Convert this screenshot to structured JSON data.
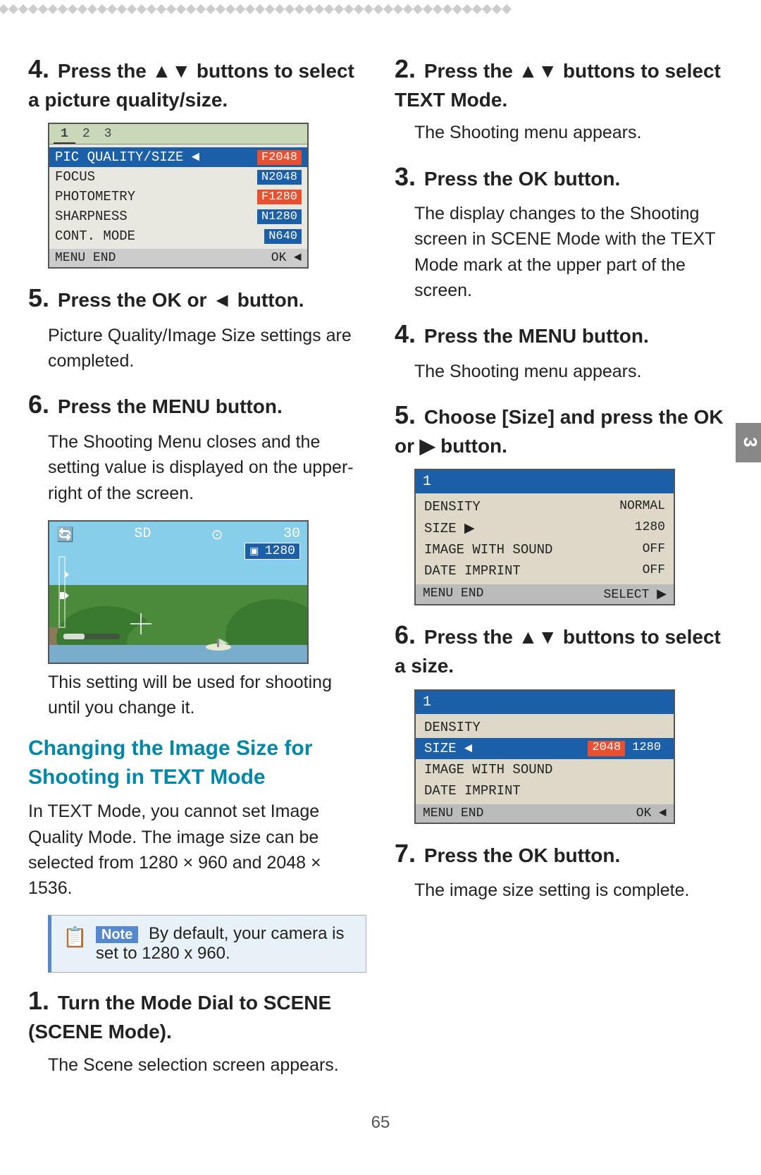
{
  "page": {
    "number": "65",
    "tab_number": "3"
  },
  "decorative_dots_count": 52,
  "left_column": {
    "step4": {
      "number": "4.",
      "heading": "Press the ▲▼ buttons to select a picture quality/size.",
      "camera_screen": {
        "tabs": [
          "1",
          "2",
          "3"
        ],
        "rows": [
          {
            "label": "PIC QUALITY/SIZE ◄",
            "value": "F2048",
            "selected": true
          },
          {
            "label": "FOCUS",
            "value": "N2048",
            "selected": false
          },
          {
            "label": "PHOTOMETRY",
            "value": "F1280",
            "selected": false
          },
          {
            "label": "SHARPNESS",
            "value": "N1280",
            "selected": false
          },
          {
            "label": "CONT. MODE",
            "value": "N640",
            "selected": false
          }
        ],
        "footer_left": "MENU END",
        "footer_right": "OK ◄"
      }
    },
    "step5": {
      "number": "5.",
      "heading": "Press the OK or ◄ button.",
      "body": "Picture Quality/Image Size settings are completed."
    },
    "step6": {
      "number": "6.",
      "heading": "Press the MENU button.",
      "body": "The Shooting Menu closes and the setting value is displayed on the upper-right of the screen.",
      "preview_badge": "1280",
      "preview_icons": [
        "🔄",
        "SD",
        "⊙",
        "30"
      ],
      "caption": "This setting will be used for shooting until you change it."
    },
    "section_heading": "Changing the Image Size for Shooting in TEXT Mode",
    "section_body": "In TEXT Mode, you cannot set Image Quality Mode. The image size can be selected from 1280 × 960 and 2048 × 1536.",
    "note": {
      "label": "Note",
      "text": "By default, your camera is set to 1280 x 960."
    },
    "step1": {
      "number": "1.",
      "heading": "Turn the Mode Dial to SCENE (SCENE Mode).",
      "body": "The Scene selection screen appears."
    }
  },
  "right_column": {
    "step2": {
      "number": "2.",
      "heading": "Press the ▲▼ buttons to select TEXT Mode.",
      "body": "The Shooting menu appears."
    },
    "step3": {
      "number": "3.",
      "heading": "Press the OK button.",
      "body": "The display changes to the Shooting screen in SCENE Mode with the TEXT Mode mark at the upper part of the screen."
    },
    "step4": {
      "number": "4.",
      "heading": "Press the MENU button.",
      "body": "The Shooting menu appears."
    },
    "step5": {
      "number": "5.",
      "heading": "Choose [Size] and press the OK or ▶ button.",
      "camera_screen": {
        "header": "1",
        "rows": [
          {
            "label": "DENSITY",
            "value": "NORMAL",
            "selected": false
          },
          {
            "label": "SIZE",
            "value": "1280",
            "arrow": "▶",
            "selected": false
          },
          {
            "label": "IMAGE WITH SOUND",
            "value": "OFF",
            "selected": false
          },
          {
            "label": "DATE IMPRINT",
            "value": "OFF",
            "selected": false
          }
        ],
        "footer_left": "MENU END",
        "footer_right": "SELECT ▶"
      }
    },
    "step6": {
      "number": "6.",
      "heading": "Press the ▲▼ buttons to select a size.",
      "camera_screen": {
        "header": "1",
        "rows": [
          {
            "label": "DENSITY",
            "value": "",
            "selected": false
          },
          {
            "label": "SIZE",
            "value": "2048",
            "arrow": "◄",
            "selected": true,
            "val2": "1280"
          },
          {
            "label": "IMAGE WITH SOUND",
            "value": "",
            "selected": false
          },
          {
            "label": "DATE IMPRINT",
            "value": "",
            "selected": false
          }
        ],
        "footer_left": "MENU END",
        "footer_right": "OK ◄"
      }
    },
    "step7": {
      "number": "7.",
      "heading": "Press the OK button.",
      "body": "The image size setting is complete."
    }
  }
}
